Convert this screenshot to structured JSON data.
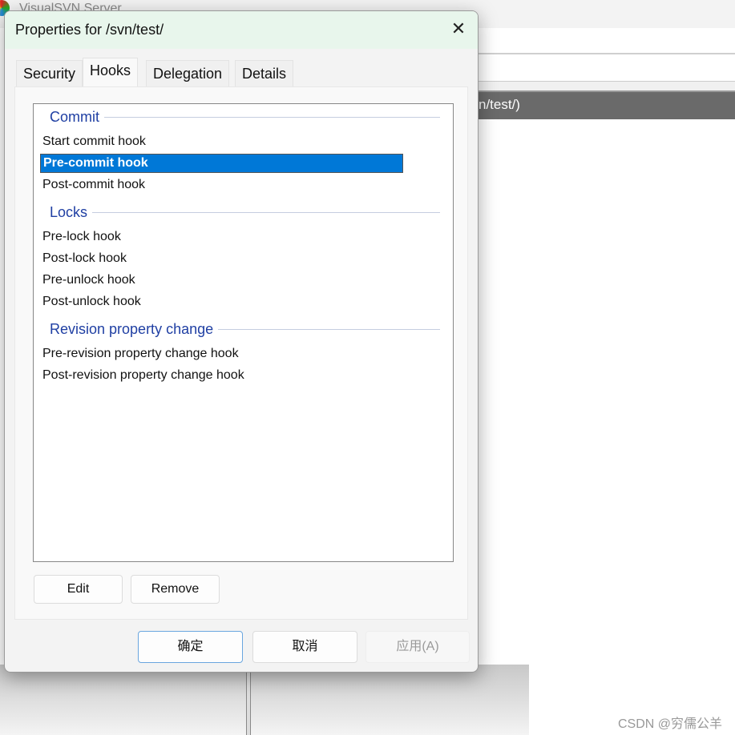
{
  "background": {
    "app_title": "VisualSVN Server",
    "path_fragment": "n/test/)"
  },
  "dialog": {
    "title": "Properties for /svn/test/",
    "close_icon": "close-icon",
    "tabs": [
      {
        "label": "Security"
      },
      {
        "label": "Hooks",
        "active": true
      },
      {
        "label": "Delegation"
      },
      {
        "label": "Details"
      }
    ],
    "groups": [
      {
        "label": "Commit",
        "items": [
          "Start commit hook",
          "Pre-commit hook",
          "Post-commit hook"
        ]
      },
      {
        "label": "Locks",
        "items": [
          "Pre-lock hook",
          "Post-lock hook",
          "Pre-unlock hook",
          "Post-unlock hook"
        ]
      },
      {
        "label": "Revision property change",
        "items": [
          "Pre-revision property change hook",
          "Post-revision property change hook"
        ]
      }
    ],
    "selected_item": "Pre-commit hook",
    "edit_label": "Edit",
    "remove_label": "Remove",
    "ok_label": "确定",
    "cancel_label": "取消",
    "apply_label": "应用(A)"
  },
  "watermark": "CSDN @穷儒公羊",
  "colors": {
    "selection": "#0078d7",
    "group_header": "#1f3fa3",
    "titlebar": "#e8f6ec"
  }
}
